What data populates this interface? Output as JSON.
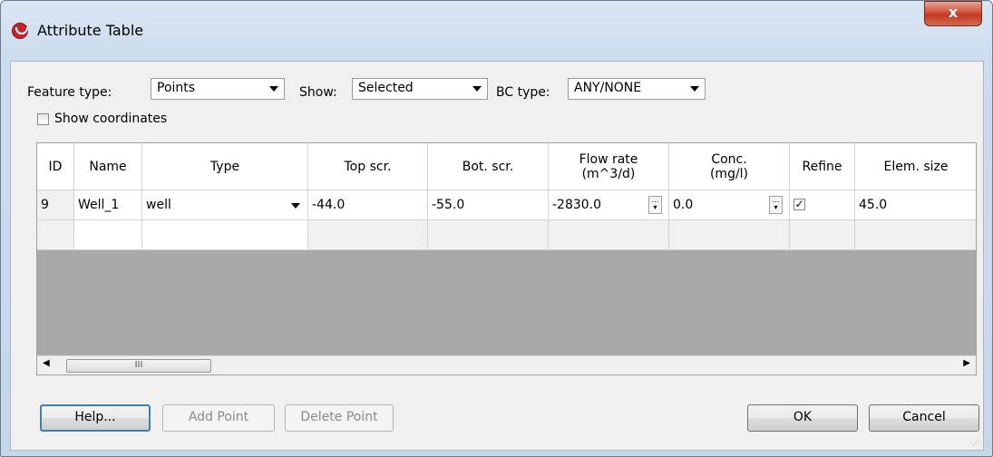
{
  "window": {
    "title": "Attribute Table",
    "close_label": "x"
  },
  "filters": {
    "feature_type_label": "Feature type:",
    "feature_type_value": "Points",
    "show_label": "Show:",
    "show_value": "Selected",
    "bc_type_label": "BC type:",
    "bc_type_value": "ANY/NONE",
    "show_coordinates_label": "Show coordinates",
    "show_coordinates_checked": false
  },
  "table": {
    "headers": [
      "ID",
      "Name",
      "Type",
      "Top scr.",
      "Bot. scr.",
      "Flow rate\n(m^3/d)",
      "Conc.\n(mg/l)",
      "Refine",
      "Elem. size"
    ],
    "rows": [
      {
        "id": "9",
        "name": "Well_1",
        "type": "well",
        "top": "-44.0",
        "bot": "-55.0",
        "flow": "-2830.0",
        "conc": "0.0",
        "refine": true,
        "elem": "45.0"
      }
    ],
    "scroll_thumb_label": "III"
  },
  "buttons": {
    "help": "Help...",
    "add_point": "Add Point",
    "delete_point": "Delete Point",
    "ok": "OK",
    "cancel": "Cancel"
  }
}
